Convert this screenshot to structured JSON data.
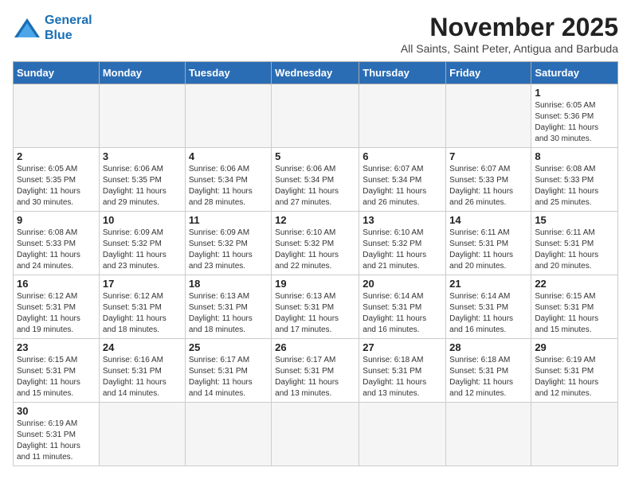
{
  "header": {
    "logo_line1": "General",
    "logo_line2": "Blue",
    "month_title": "November 2025",
    "subtitle": "All Saints, Saint Peter, Antigua and Barbuda"
  },
  "weekdays": [
    "Sunday",
    "Monday",
    "Tuesday",
    "Wednesday",
    "Thursday",
    "Friday",
    "Saturday"
  ],
  "weeks": [
    [
      {
        "day": "",
        "info": ""
      },
      {
        "day": "",
        "info": ""
      },
      {
        "day": "",
        "info": ""
      },
      {
        "day": "",
        "info": ""
      },
      {
        "day": "",
        "info": ""
      },
      {
        "day": "",
        "info": ""
      },
      {
        "day": "1",
        "info": "Sunrise: 6:05 AM\nSunset: 5:36 PM\nDaylight: 11 hours\nand 30 minutes."
      }
    ],
    [
      {
        "day": "2",
        "info": "Sunrise: 6:05 AM\nSunset: 5:35 PM\nDaylight: 11 hours\nand 30 minutes."
      },
      {
        "day": "3",
        "info": "Sunrise: 6:06 AM\nSunset: 5:35 PM\nDaylight: 11 hours\nand 29 minutes."
      },
      {
        "day": "4",
        "info": "Sunrise: 6:06 AM\nSunset: 5:34 PM\nDaylight: 11 hours\nand 28 minutes."
      },
      {
        "day": "5",
        "info": "Sunrise: 6:06 AM\nSunset: 5:34 PM\nDaylight: 11 hours\nand 27 minutes."
      },
      {
        "day": "6",
        "info": "Sunrise: 6:07 AM\nSunset: 5:34 PM\nDaylight: 11 hours\nand 26 minutes."
      },
      {
        "day": "7",
        "info": "Sunrise: 6:07 AM\nSunset: 5:33 PM\nDaylight: 11 hours\nand 26 minutes."
      },
      {
        "day": "8",
        "info": "Sunrise: 6:08 AM\nSunset: 5:33 PM\nDaylight: 11 hours\nand 25 minutes."
      }
    ],
    [
      {
        "day": "9",
        "info": "Sunrise: 6:08 AM\nSunset: 5:33 PM\nDaylight: 11 hours\nand 24 minutes."
      },
      {
        "day": "10",
        "info": "Sunrise: 6:09 AM\nSunset: 5:32 PM\nDaylight: 11 hours\nand 23 minutes."
      },
      {
        "day": "11",
        "info": "Sunrise: 6:09 AM\nSunset: 5:32 PM\nDaylight: 11 hours\nand 23 minutes."
      },
      {
        "day": "12",
        "info": "Sunrise: 6:10 AM\nSunset: 5:32 PM\nDaylight: 11 hours\nand 22 minutes."
      },
      {
        "day": "13",
        "info": "Sunrise: 6:10 AM\nSunset: 5:32 PM\nDaylight: 11 hours\nand 21 minutes."
      },
      {
        "day": "14",
        "info": "Sunrise: 6:11 AM\nSunset: 5:31 PM\nDaylight: 11 hours\nand 20 minutes."
      },
      {
        "day": "15",
        "info": "Sunrise: 6:11 AM\nSunset: 5:31 PM\nDaylight: 11 hours\nand 20 minutes."
      }
    ],
    [
      {
        "day": "16",
        "info": "Sunrise: 6:12 AM\nSunset: 5:31 PM\nDaylight: 11 hours\nand 19 minutes."
      },
      {
        "day": "17",
        "info": "Sunrise: 6:12 AM\nSunset: 5:31 PM\nDaylight: 11 hours\nand 18 minutes."
      },
      {
        "day": "18",
        "info": "Sunrise: 6:13 AM\nSunset: 5:31 PM\nDaylight: 11 hours\nand 18 minutes."
      },
      {
        "day": "19",
        "info": "Sunrise: 6:13 AM\nSunset: 5:31 PM\nDaylight: 11 hours\nand 17 minutes."
      },
      {
        "day": "20",
        "info": "Sunrise: 6:14 AM\nSunset: 5:31 PM\nDaylight: 11 hours\nand 16 minutes."
      },
      {
        "day": "21",
        "info": "Sunrise: 6:14 AM\nSunset: 5:31 PM\nDaylight: 11 hours\nand 16 minutes."
      },
      {
        "day": "22",
        "info": "Sunrise: 6:15 AM\nSunset: 5:31 PM\nDaylight: 11 hours\nand 15 minutes."
      }
    ],
    [
      {
        "day": "23",
        "info": "Sunrise: 6:15 AM\nSunset: 5:31 PM\nDaylight: 11 hours\nand 15 minutes."
      },
      {
        "day": "24",
        "info": "Sunrise: 6:16 AM\nSunset: 5:31 PM\nDaylight: 11 hours\nand 14 minutes."
      },
      {
        "day": "25",
        "info": "Sunrise: 6:17 AM\nSunset: 5:31 PM\nDaylight: 11 hours\nand 14 minutes."
      },
      {
        "day": "26",
        "info": "Sunrise: 6:17 AM\nSunset: 5:31 PM\nDaylight: 11 hours\nand 13 minutes."
      },
      {
        "day": "27",
        "info": "Sunrise: 6:18 AM\nSunset: 5:31 PM\nDaylight: 11 hours\nand 13 minutes."
      },
      {
        "day": "28",
        "info": "Sunrise: 6:18 AM\nSunset: 5:31 PM\nDaylight: 11 hours\nand 12 minutes."
      },
      {
        "day": "29",
        "info": "Sunrise: 6:19 AM\nSunset: 5:31 PM\nDaylight: 11 hours\nand 12 minutes."
      }
    ],
    [
      {
        "day": "30",
        "info": "Sunrise: 6:19 AM\nSunset: 5:31 PM\nDaylight: 11 hours\nand 11 minutes."
      },
      {
        "day": "",
        "info": ""
      },
      {
        "day": "",
        "info": ""
      },
      {
        "day": "",
        "info": ""
      },
      {
        "day": "",
        "info": ""
      },
      {
        "day": "",
        "info": ""
      },
      {
        "day": "",
        "info": ""
      }
    ]
  ]
}
